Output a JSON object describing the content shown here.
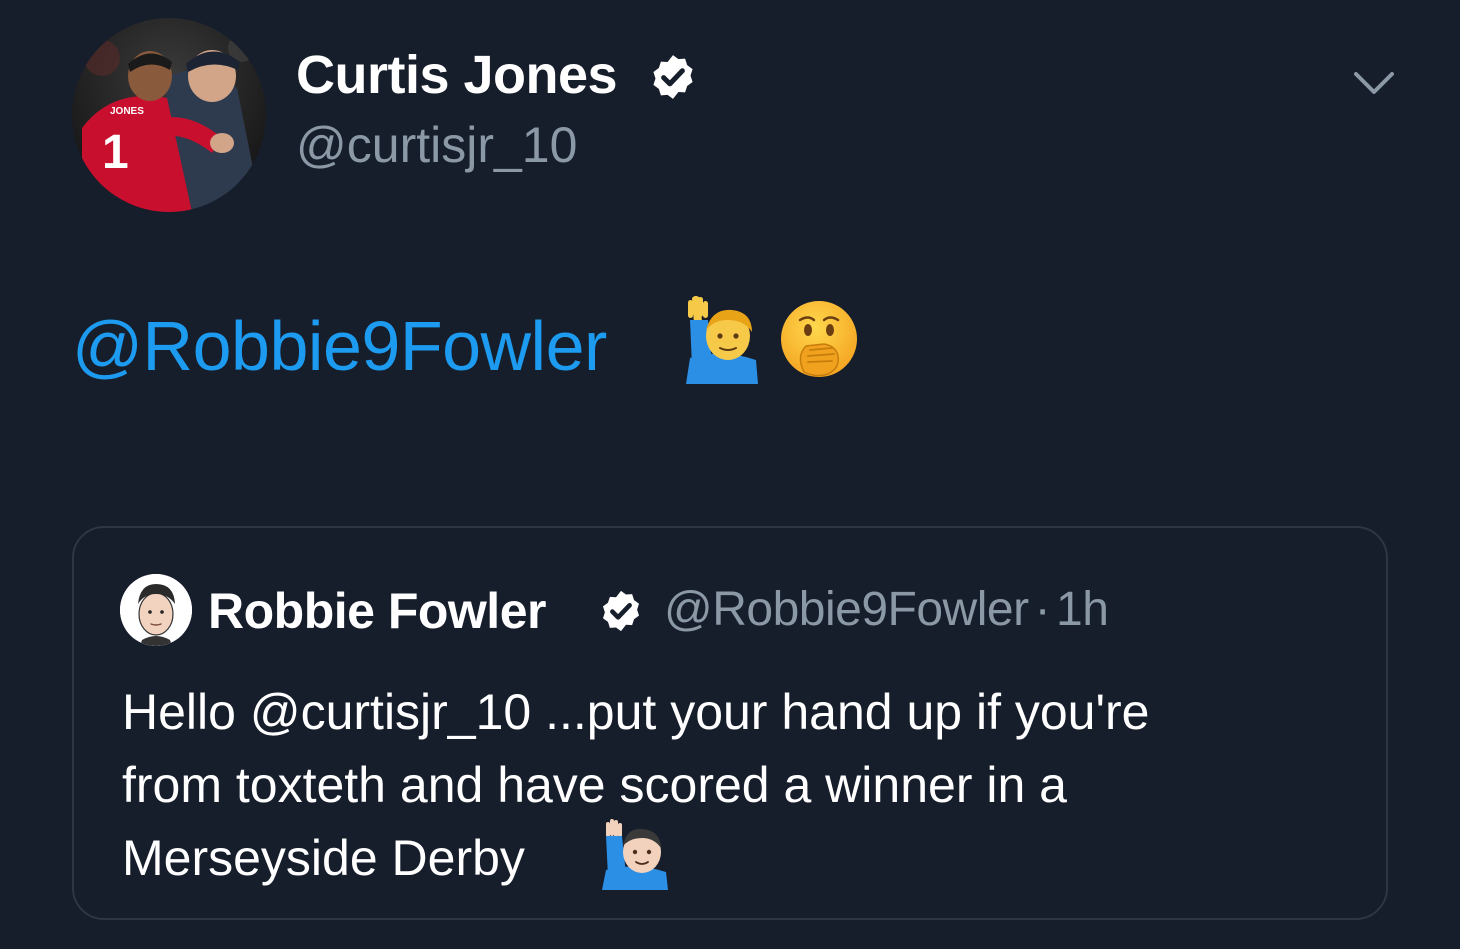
{
  "author": {
    "display_name": "Curtis Jones",
    "handle": "@curtisjr_10",
    "verified": true,
    "avatar_icon": "profile-photo"
  },
  "tweet": {
    "text": "@Robbie9Fowler",
    "emojis": [
      "man-raising-hand-icon",
      "face-with-hand-over-mouth-icon"
    ],
    "mention_color": "#1d9bf0"
  },
  "menu": {
    "icon": "chevron-down-icon"
  },
  "quoted_tweet": {
    "display_name": "Robbie Fowler",
    "handle": "@Robbie9Fowler",
    "separator": "·",
    "time": "1h",
    "verified": true,
    "body_lines": [
      "Hello @curtisjr_10 ...put your hand up if you're",
      "from toxteth and have scored a winner in a",
      "Merseyside Derby"
    ],
    "trailing_emoji": "man-raising-hand-icon"
  },
  "colors": {
    "background": "#161d2b",
    "secondary_text": "#8b98a6",
    "border": "#2c3645"
  }
}
